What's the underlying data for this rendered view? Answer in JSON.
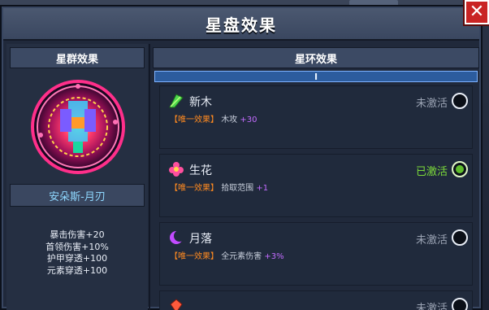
{
  "window": {
    "title": "星盘效果",
    "close_label": "✕"
  },
  "left_panel": {
    "header": "星群效果",
    "emblem_name": "安朵斯-月刃",
    "stats": [
      "暴击伤害+20",
      "首领伤害+10%",
      "护甲穿透+100",
      "元素穿透+100"
    ]
  },
  "right_panel": {
    "header": "星环效果",
    "scroll_indicator": "I",
    "entries": [
      {
        "name": "新木",
        "status": "未激活",
        "tag": "【唯一效果】",
        "effect": "木攻",
        "bonus": "+30",
        "active": false,
        "icon": "leaf-icon"
      },
      {
        "name": "生花",
        "status": "已激活",
        "tag": "【唯一效果】",
        "effect": "拾取范围",
        "bonus": "+1",
        "active": true,
        "icon": "flower-icon"
      },
      {
        "name": "月落",
        "status": "未激活",
        "tag": "【唯一效果】",
        "effect": "全元素伤害",
        "bonus": "+3%",
        "active": false,
        "icon": "crescent-moon-icon"
      },
      {
        "name": "",
        "status": "未激活",
        "active": false,
        "icon": "gem-icon"
      }
    ]
  },
  "colors": {
    "active_green": "#7ddc3a",
    "tag_orange": "#ff8a20",
    "bonus_purple": "#c36cff",
    "name_cyan": "#8fd8ff",
    "close_red": "#c92424"
  }
}
